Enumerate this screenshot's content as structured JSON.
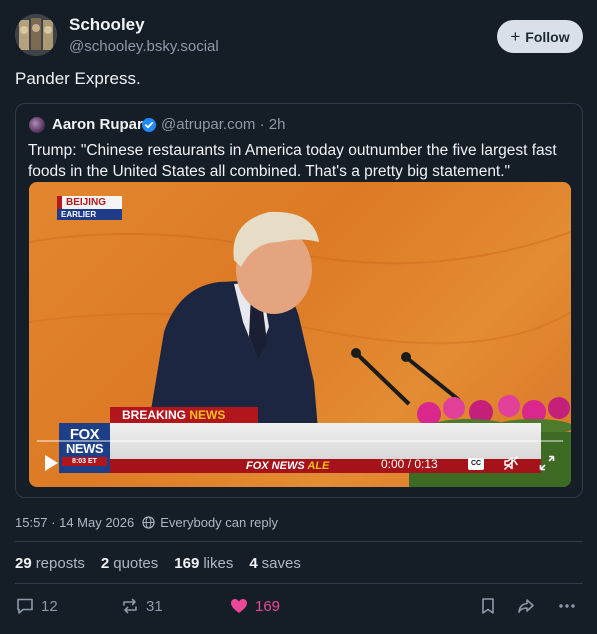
{
  "author": {
    "name": "Schooley",
    "handle": "@schooley.bsky.social"
  },
  "follow_label": "Follow",
  "post_text": "Pander Express.",
  "quote": {
    "name": "Aaron Rupar",
    "handle_time": "@atrupar.com · 2h",
    "text": "Trump: \"Chinese restaurants in America today outnumber the five largest fast foods in the United States all combined. That's a pretty big statement.\"",
    "video": {
      "location_tag": "BEIJING",
      "time_tag": "EARLIER",
      "breaking_prefix": "BREAKING ",
      "breaking_highlight": "NEWS",
      "ticker_prefix": "FOX NEWS ",
      "ticker_alert": "ALE",
      "logo_line1": "FOX",
      "logo_line2": "NEWS",
      "logo_time": "8:03 ET",
      "time_display": "0:00 / 0:13",
      "cc_label": "CC",
      "progress": 0
    }
  },
  "meta": {
    "timestamp": "15:57 · 14 May 2026",
    "reply_setting": "Everybody can reply"
  },
  "stats": [
    {
      "count": "29",
      "label": "reposts"
    },
    {
      "count": "2",
      "label": "quotes"
    },
    {
      "count": "169",
      "label": "likes"
    },
    {
      "count": "4",
      "label": "saves"
    }
  ],
  "actions": {
    "replies": "12",
    "reposts": "31",
    "likes": "169"
  },
  "colors": {
    "background": "#151d27",
    "like": "#ec4899",
    "muted": "#8d9aa8"
  }
}
